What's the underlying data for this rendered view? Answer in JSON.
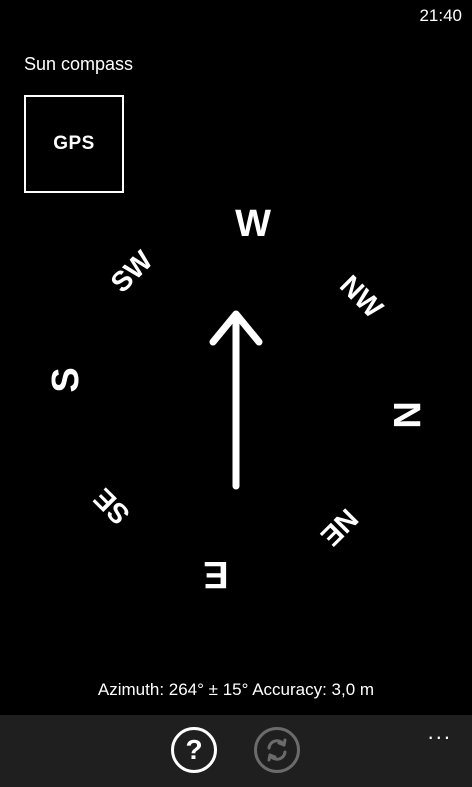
{
  "status_bar": {
    "time": "21:40"
  },
  "app": {
    "title": "Sun compass"
  },
  "gps_button": {
    "label": "GPS"
  },
  "compass": {
    "north_azimuth_deg": 264,
    "needle_direction": "up",
    "labels": {
      "N": "N",
      "NE": "NE",
      "E": "E",
      "SE": "SE",
      "S": "S",
      "SW": "SW",
      "W": "W",
      "NW": "NW"
    }
  },
  "readout": {
    "text": "Azimuth: 264° ± 15° Accuracy: 3,0 m"
  },
  "app_bar": {
    "help_icon": "help-circle-icon",
    "help_glyph": "?",
    "refresh_icon": "refresh-icon",
    "more_glyph": "..."
  }
}
